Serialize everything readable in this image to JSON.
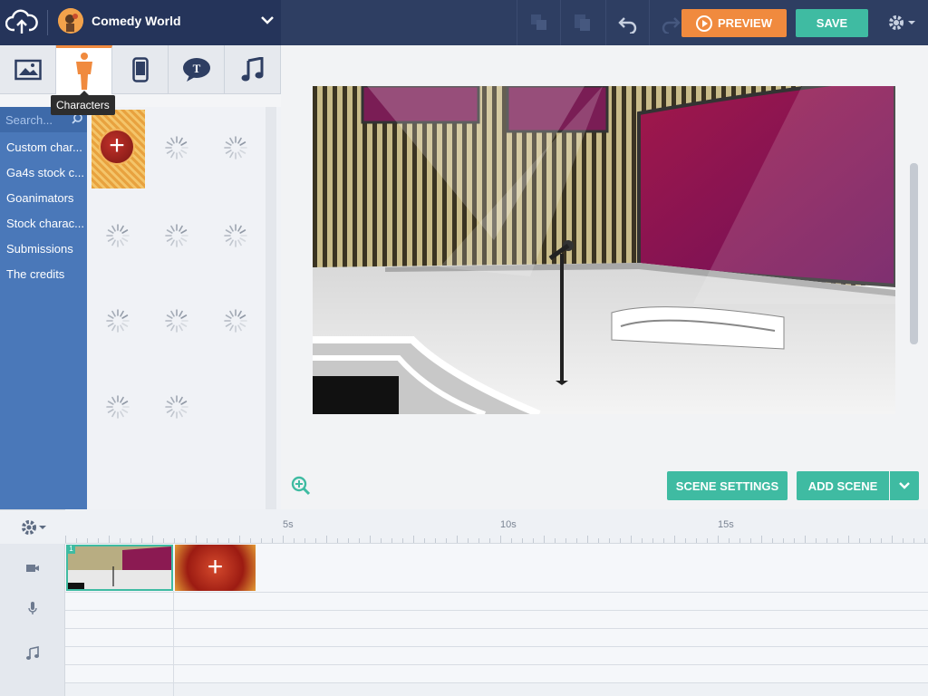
{
  "header": {
    "title": "Comedy World",
    "preview_label": "PREVIEW",
    "save_label": "SAVE"
  },
  "asset_tabs": {
    "items": [
      "background-icon",
      "character-icon",
      "prop-icon",
      "text-icon",
      "music-icon"
    ],
    "active": "character-icon",
    "tooltip": "Characters"
  },
  "sidebar": {
    "search_placeholder": "Search...",
    "categories": [
      {
        "label": "Custom char..."
      },
      {
        "label": "Ga4s stock c..."
      },
      {
        "label": "Goanimators"
      },
      {
        "label": "Stock charac..."
      },
      {
        "label": "Submissions"
      },
      {
        "label": "The credits"
      }
    ]
  },
  "stage": {
    "scene_settings_label": "SCENE SETTINGS",
    "add_scene_label": "ADD SCENE"
  },
  "timeline": {
    "ruler_labels": [
      "5s",
      "10s",
      "15s"
    ],
    "scene_number": "1"
  },
  "colors": {
    "accent_orange": "#f08a3e",
    "accent_teal": "#3fbba2",
    "topbar": "#2e3e62",
    "sidebar_blue": "#4a78b9"
  }
}
